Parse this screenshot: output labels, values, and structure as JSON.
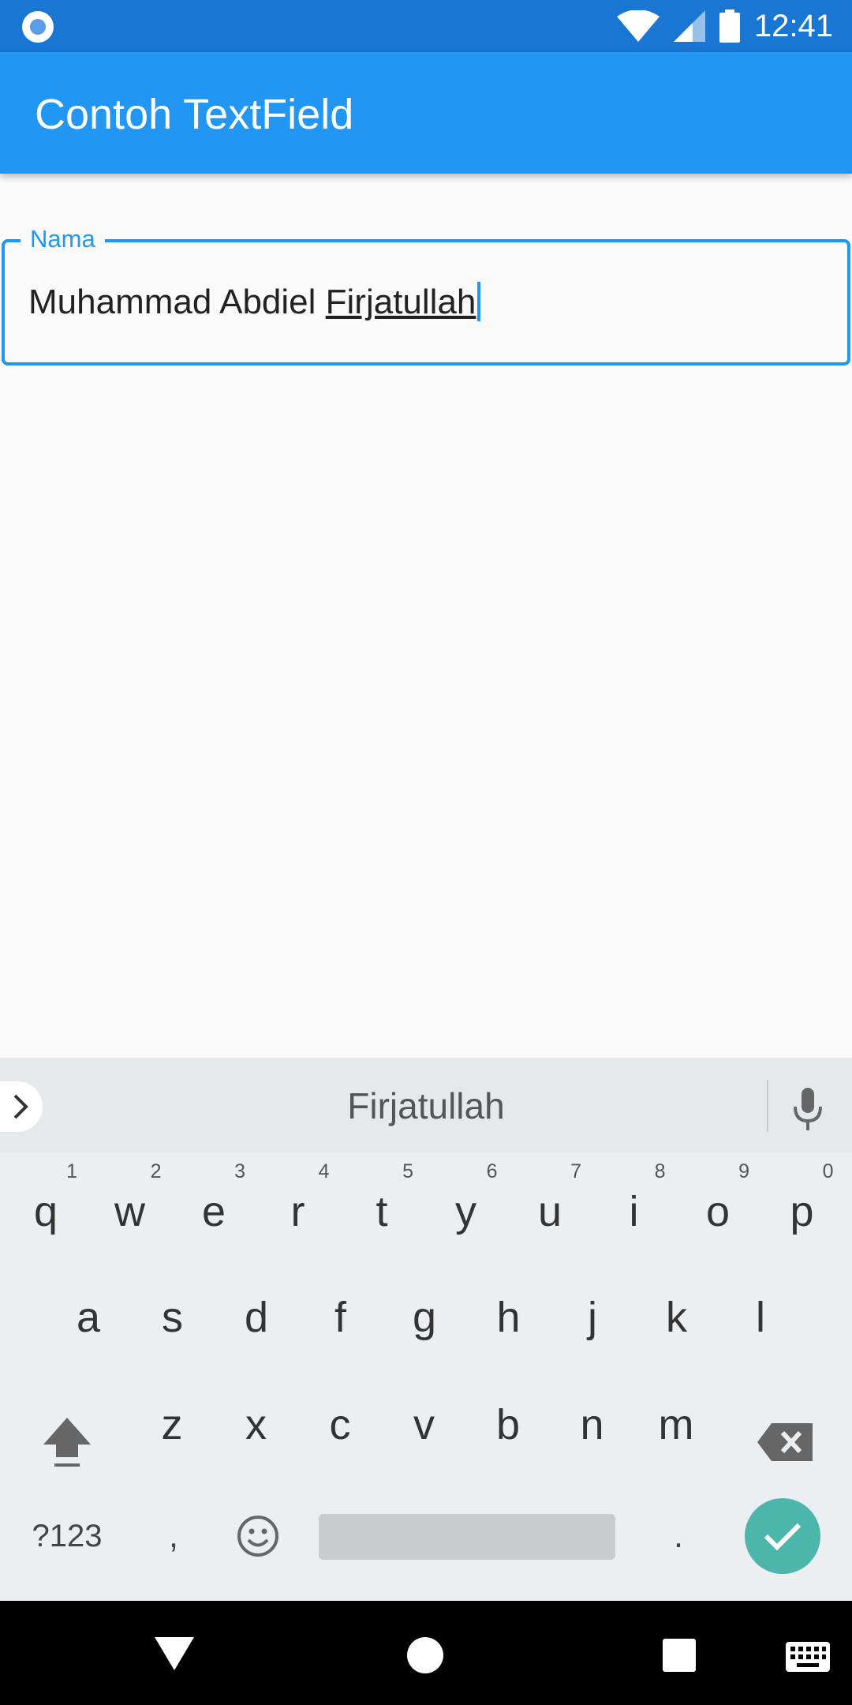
{
  "status_bar": {
    "time": "12:41",
    "icons": [
      "app-notification-icon",
      "wifi-icon",
      "signal-icon",
      "battery-icon"
    ]
  },
  "app_bar": {
    "title": "Contoh TextField",
    "color": "#2196f3"
  },
  "text_field": {
    "label": "Nama",
    "value_prefix": "Muhammad Abdiel ",
    "value_composing": "Firjatullah",
    "accent_color": "#2196f3"
  },
  "keyboard": {
    "suggestion": "Firjatullah",
    "row1": [
      {
        "ch": "q",
        "num": "1"
      },
      {
        "ch": "w",
        "num": "2"
      },
      {
        "ch": "e",
        "num": "3"
      },
      {
        "ch": "r",
        "num": "4"
      },
      {
        "ch": "t",
        "num": "5"
      },
      {
        "ch": "y",
        "num": "6"
      },
      {
        "ch": "u",
        "num": "7"
      },
      {
        "ch": "i",
        "num": "8"
      },
      {
        "ch": "o",
        "num": "9"
      },
      {
        "ch": "p",
        "num": "0"
      }
    ],
    "row2": [
      "a",
      "s",
      "d",
      "f",
      "g",
      "h",
      "j",
      "k",
      "l"
    ],
    "row3": [
      "z",
      "x",
      "c",
      "v",
      "b",
      "n",
      "m"
    ],
    "symbols_label": "?123",
    "comma_label": ",",
    "period_label": ".",
    "enter_color": "#4db6ac"
  },
  "nav_bar": {
    "icons": [
      "back-icon",
      "home-icon",
      "recent-apps-icon",
      "keyboard-switch-icon"
    ]
  }
}
